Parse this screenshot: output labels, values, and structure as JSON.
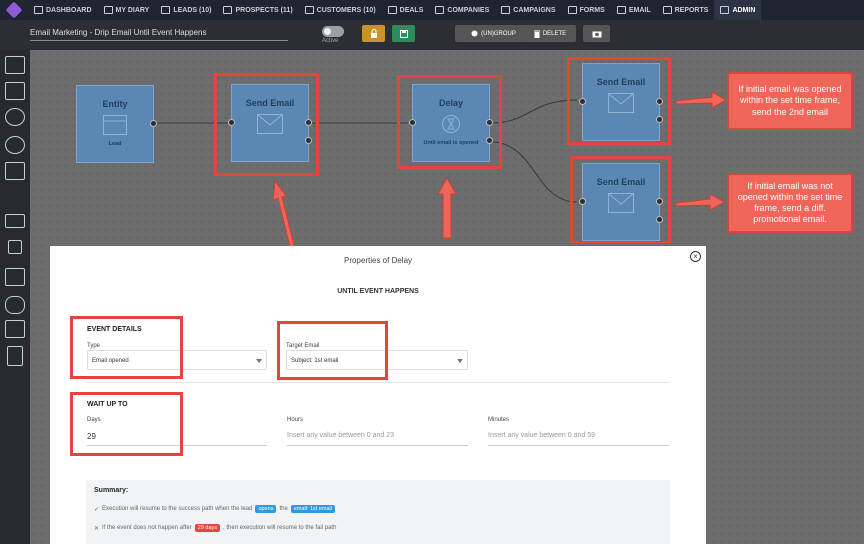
{
  "nav": {
    "items": [
      {
        "label": "DASHBOARD",
        "icon": "dashboard-icon"
      },
      {
        "label": "MY DIARY",
        "icon": "diary-icon"
      },
      {
        "label": "LEADS (10)",
        "icon": "leads-icon"
      },
      {
        "label": "PROSPECTS (11)",
        "icon": "prospects-icon"
      },
      {
        "label": "CUSTOMERS (10)",
        "icon": "customers-icon"
      },
      {
        "label": "DEALS",
        "icon": "deals-icon"
      },
      {
        "label": "COMPANIES",
        "icon": "companies-icon"
      },
      {
        "label": "CAMPAIGNS",
        "icon": "campaigns-icon"
      },
      {
        "label": "FORMS",
        "icon": "forms-icon"
      },
      {
        "label": "EMAIL",
        "icon": "email-icon"
      },
      {
        "label": "REPORTS",
        "icon": "reports-icon"
      },
      {
        "label": "ADMIN",
        "icon": "admin-icon",
        "active": true
      }
    ]
  },
  "toolbar": {
    "workflow_title": "Email Marketing - Drip Email Until Event Happens",
    "active_label": "Active",
    "ungroup_label": "(UN)GROUP",
    "delete_label": "DELETE"
  },
  "nodes": {
    "entity": {
      "title": "Entity",
      "sub": "Lead"
    },
    "send1": {
      "title": "Send Email"
    },
    "delay": {
      "title": "Delay",
      "sub": "Until email is opened"
    },
    "send2": {
      "title": "Send Email"
    },
    "send3": {
      "title": "Send Email"
    }
  },
  "callouts": {
    "top": "If initial email was opened within the set time frame, send the 2nd email",
    "bottom": "If initial email was not opened within the set time frame, send a diff. promotional email."
  },
  "modal": {
    "title": "Properties of Delay",
    "subtitle": "UNTIL EVENT HAPPENS",
    "event_details": {
      "heading": "EVENT DETAILS",
      "type_label": "Type",
      "type_value": "Email opened",
      "target_label": "Target Email",
      "target_value": "Subject: 1st email"
    },
    "wait": {
      "heading": "WAIT UP TO",
      "days_label": "Days",
      "days_value": "29",
      "hours_label": "Hours",
      "hours_placeholder": "Insert any value between 0 and 23",
      "minutes_label": "Minutes",
      "minutes_placeholder": "Insert any value between 0 and 59"
    },
    "summary": {
      "title": "Summary:",
      "line1_a": "Execution will resume to the success path when the lead",
      "line1_chip1": "opens",
      "line1_b": "the",
      "line1_chip2": "email: 1st email",
      "line2_a": "If the event does not happen after",
      "line2_chip": "29 days",
      "line2_b": ", then execution will resume to the fail path"
    }
  },
  "colors": {
    "node": "#5a87b3",
    "highlight": "#e2453c",
    "chip_blue": "#2f9ae0",
    "chip_red": "#e04a3c"
  }
}
